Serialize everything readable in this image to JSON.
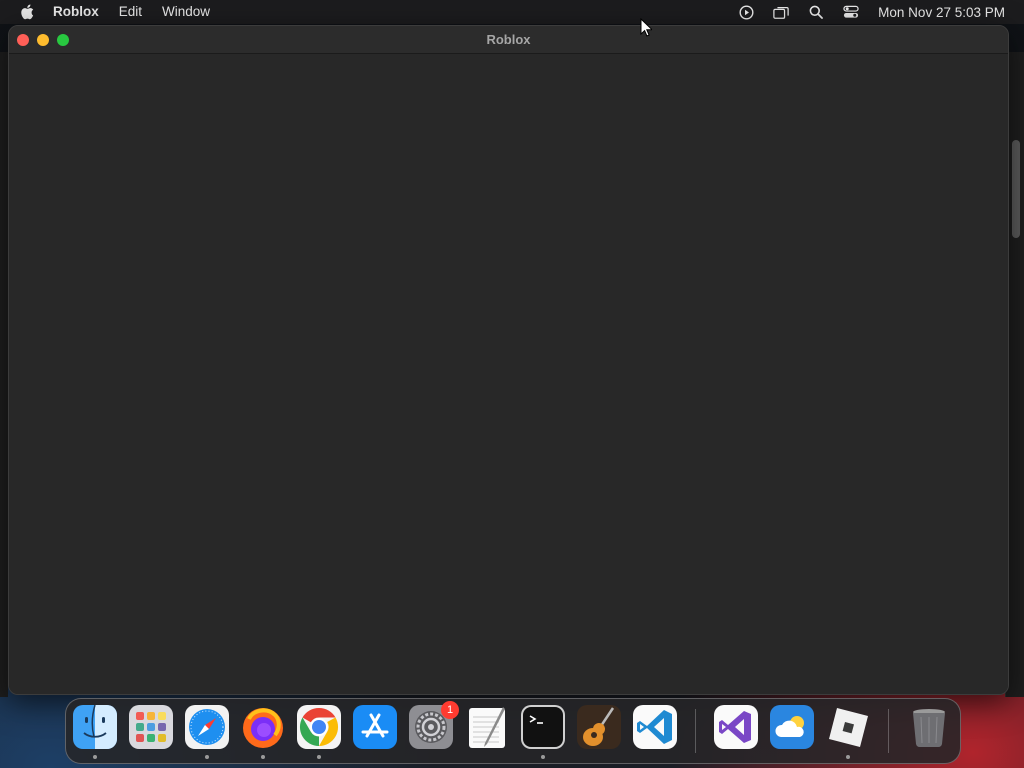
{
  "menubar": {
    "app_name": "Roblox",
    "items": [
      "Edit",
      "Window"
    ],
    "clock": "Mon Nov 27  5:03 PM"
  },
  "window": {
    "title": "Roblox"
  },
  "dock": {
    "apps": [
      {
        "name": "Finder",
        "icon": "finder-icon",
        "running": true
      },
      {
        "name": "Launchpad",
        "icon": "launchpad-icon",
        "running": false
      },
      {
        "name": "Safari",
        "icon": "safari-icon",
        "running": true
      },
      {
        "name": "Firefox",
        "icon": "firefox-icon",
        "running": true
      },
      {
        "name": "Google Chrome",
        "icon": "chrome-icon",
        "running": true
      },
      {
        "name": "App Store",
        "icon": "app-store-icon",
        "running": false
      },
      {
        "name": "System Settings",
        "icon": "system-settings-icon",
        "running": false,
        "badge": "1"
      },
      {
        "name": "TextEdit",
        "icon": "textedit-icon",
        "running": false
      },
      {
        "name": "Terminal",
        "icon": "terminal-icon",
        "running": true
      },
      {
        "name": "GarageBand",
        "icon": "garageband-icon",
        "running": false
      },
      {
        "name": "Visual Studio Code",
        "icon": "vscode-icon",
        "running": false
      },
      {
        "name": "Visual Studio",
        "icon": "visual-studio-icon",
        "running": false
      },
      {
        "name": "Weather",
        "icon": "weather-icon",
        "running": false
      },
      {
        "name": "Roblox",
        "icon": "roblox-icon",
        "running": true
      },
      {
        "name": "Trash",
        "icon": "trash-icon",
        "running": false
      }
    ]
  },
  "colors": {
    "close": "#ff5f57",
    "minimize": "#febc2e",
    "maximize": "#28c840",
    "badge": "#ff3b30"
  }
}
